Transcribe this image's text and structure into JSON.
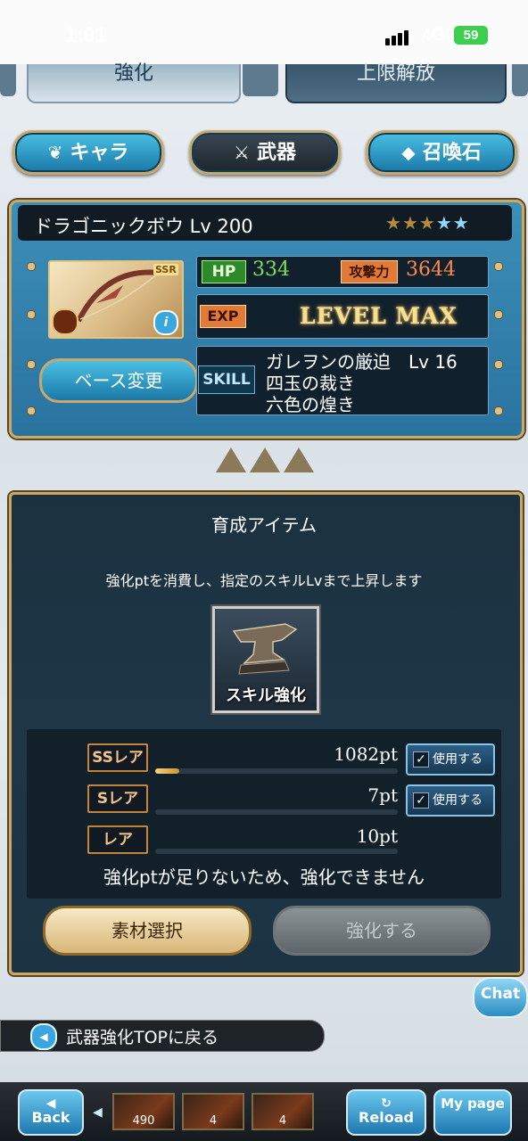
{
  "status": {
    "time": "1:01",
    "network": "4G",
    "battery": "59"
  },
  "tabs": [
    {
      "label": "強化"
    },
    {
      "label": "上限解放"
    }
  ],
  "categories": [
    {
      "label": "キャラ"
    },
    {
      "label": "武器"
    },
    {
      "label": "召喚石"
    }
  ],
  "weapon": {
    "name": "ドラゴニックボウ Lv 200",
    "rarity": "SSR",
    "hp_label": "HP",
    "hp": "334",
    "atk_label": "攻撃力",
    "atk": "3644",
    "exp_label": "EXP",
    "exp_value": "LEVEL MAX",
    "skill_label": "SKILL",
    "skills": [
      "ガレヲンの厳迫　Lv 16",
      "四玉の裁き",
      "六色の煌き"
    ],
    "base_change": "ベース変更",
    "stars_gold": 3,
    "stars_blue": 2
  },
  "items": {
    "title": "育成アイテム",
    "description": "強化ptを消費し、指定のスキルLvまで上昇します",
    "item_caption": "スキル強化",
    "rows": [
      {
        "label": "SSレア",
        "points": "1082pt",
        "use": "使用する",
        "fill": 0.1
      },
      {
        "label": "Sレア",
        "points": "7pt",
        "use": "使用する",
        "fill": 0
      },
      {
        "label": "レア",
        "points": "10pt",
        "fill": 0
      }
    ],
    "warning": "強化ptが足りないため、強化できません",
    "select_material": "素材選択",
    "enhance": "強化する"
  },
  "chat": "Chat",
  "back_link": "武器強化TOPに戻る",
  "nav": {
    "back": "Back",
    "reload": "Reload",
    "my_page": "My page",
    "thumbs": [
      "490",
      "4",
      "4"
    ]
  }
}
